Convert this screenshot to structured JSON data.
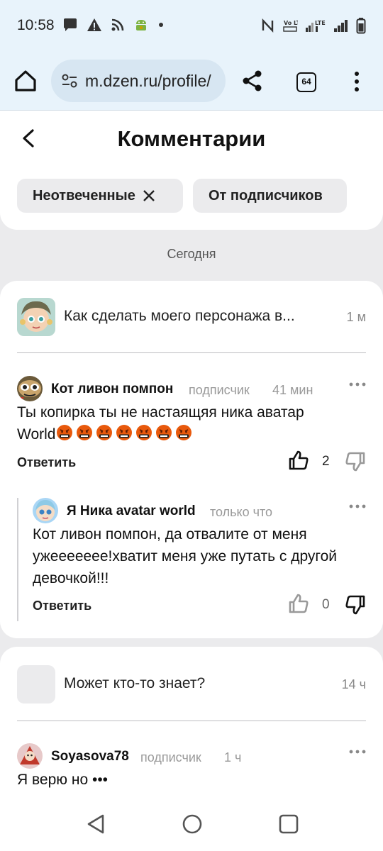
{
  "status_bar": {
    "time": "10:58",
    "left_icons": [
      "chat-bubble-icon",
      "warning-icon",
      "rss-icon",
      "android-icon",
      "dot-icon"
    ],
    "right_icons": [
      "nfc-icon",
      "volte-icon",
      "signal-lte-icon",
      "signal-icon",
      "battery-icon"
    ],
    "volte_text": "Vo LTE",
    "lte_text": "LTE"
  },
  "browser": {
    "url": "m.dzen.ru/profile/",
    "tabs_count": "64"
  },
  "header": {
    "title": "Комментарии",
    "filters": [
      {
        "label": "Неотвеченные",
        "active": true
      },
      {
        "label": "От подписчиков",
        "active": false
      }
    ]
  },
  "date_label": "Сегодня",
  "posts": [
    {
      "title": "Как сделать моего персонажа в...",
      "time": "1 м",
      "comments": [
        {
          "author": "Кот ливон помпон",
          "badge": "подписчик",
          "time": "41 мин",
          "text_line1": "Ты копирка ты не настаящяя ника аватар",
          "text_line2": "World",
          "emoji_count": 7,
          "reply_label": "Ответить",
          "likes": "2"
        },
        {
          "author": "Я Ника avatar world",
          "time": "только что",
          "text_line1": "Кот ливон помпон, да отвалите от меня",
          "text_line2": "ужеееееее!хватит меня уже путать с другой",
          "text_line3": "девочкой!!!",
          "reply_label": "Ответить",
          "likes": "0"
        }
      ]
    },
    {
      "title": "Может кто-то знает?",
      "time": "14 ч",
      "comments": [
        {
          "author": "Soyasova78",
          "badge": "подписчик",
          "time": "1 ч",
          "text_line1": "Я верю но •••"
        }
      ]
    }
  ],
  "colors": {
    "status_bg": "#e8f3fb",
    "url_bg": "#d7e6f2",
    "page_bg": "#ebebed",
    "card_bg": "#ffffff",
    "chip_bg": "#ebebed",
    "muted_text": "#999999"
  }
}
